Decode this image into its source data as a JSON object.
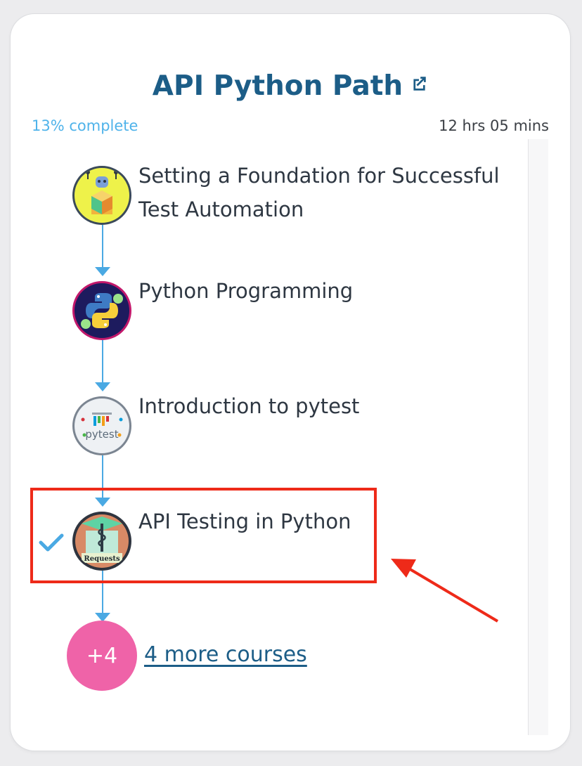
{
  "path": {
    "title": "API Python Path",
    "progress_label": "13% complete",
    "duration": "12 hrs 05 mins"
  },
  "courses": [
    {
      "title_line1": "Setting a Foundation for Successful",
      "title_line2": "Test Automation",
      "icon": "robot-blocks-icon"
    },
    {
      "title": "Python Programming",
      "icon": "python-logo-icon"
    },
    {
      "title": "Introduction to pytest",
      "icon": "pytest-logo-icon",
      "logo_text": "pytest"
    },
    {
      "title": "API Testing in Python",
      "icon": "requests-logo-icon",
      "logo_text": "Requests",
      "completed": true
    }
  ],
  "more": {
    "badge": "+4",
    "link": "4 more courses"
  },
  "colors": {
    "title": "#1c5d87",
    "progress": "#4fb3ea",
    "connector": "#4aa9e3",
    "highlight": "#ee2a19",
    "more_badge": "#ef63a8"
  }
}
